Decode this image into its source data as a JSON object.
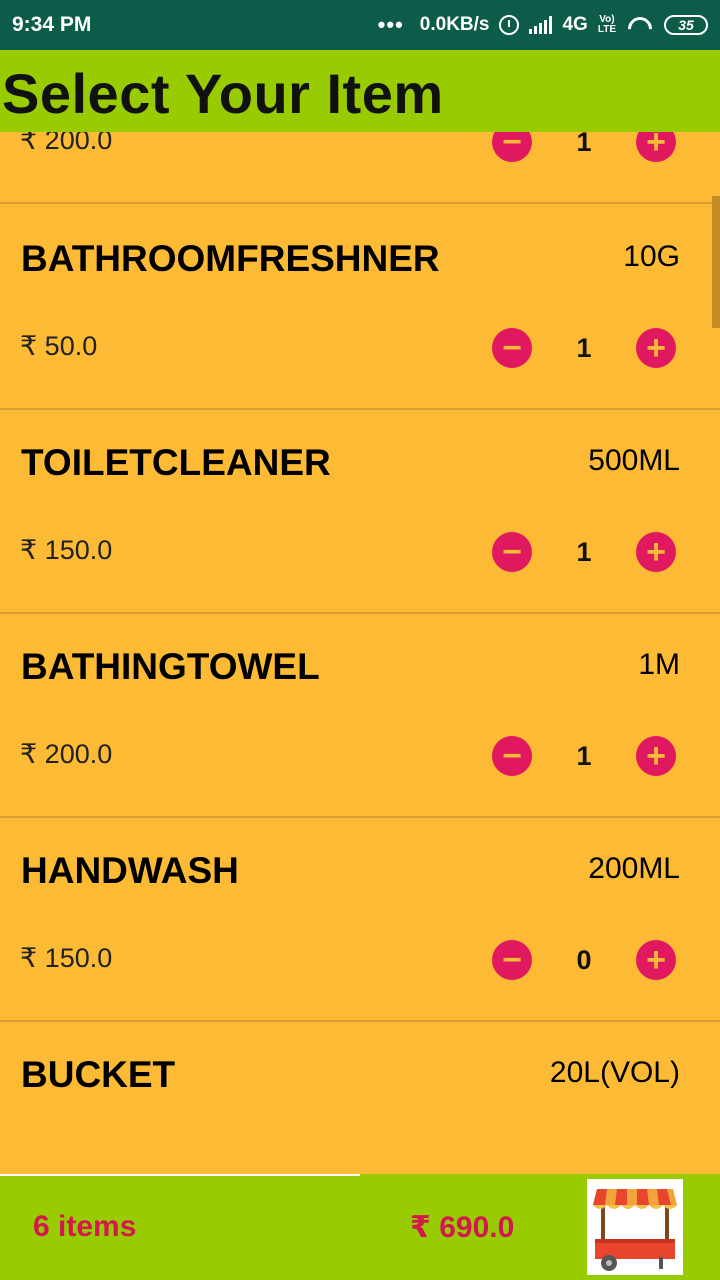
{
  "status": {
    "time": "9:34 PM",
    "more": "•••",
    "network_speed": "0.0KB/s",
    "network_type": "4G",
    "volte_top": "Vo)",
    "volte_bottom": "LTE",
    "battery": "35"
  },
  "header": {
    "title": "Select Your Item"
  },
  "items": [
    {
      "name": "",
      "size": "",
      "price": "₹ 200.0",
      "qty": "1",
      "minus": "−",
      "plus": "+"
    },
    {
      "name": "BATHROOMFRESHNER",
      "size": "10G",
      "price": "₹ 50.0",
      "qty": "1",
      "minus": "−",
      "plus": "+"
    },
    {
      "name": "TOILETCLEANER",
      "size": "500ML",
      "price": "₹ 150.0",
      "qty": "1",
      "minus": "−",
      "plus": "+"
    },
    {
      "name": "BATHINGTOWEL",
      "size": "1M",
      "price": "₹ 200.0",
      "qty": "1",
      "minus": "−",
      "plus": "+"
    },
    {
      "name": "HANDWASH",
      "size": "200ML",
      "price": "₹ 150.0",
      "qty": "0",
      "minus": "−",
      "plus": "+"
    },
    {
      "name": "BUCKET",
      "size": "20L(VOL)",
      "price": "",
      "qty": "",
      "minus": "",
      "plus": ""
    }
  ],
  "footer": {
    "item_count": "6 items",
    "total": "₹ 690.0",
    "cart_icon": "cart-stall-icon"
  },
  "colors": {
    "status_bar": "#0D5C4A",
    "title_bar": "#99CC00",
    "list_bg": "#FDBA35",
    "button": "#E0185F",
    "footer_text": "#D3174F"
  }
}
